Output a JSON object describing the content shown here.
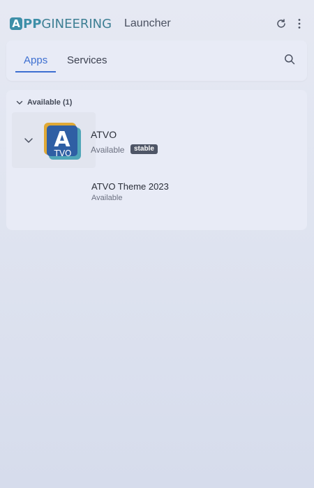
{
  "titlebar": {
    "logo_a": "A",
    "logo_pp": "PP",
    "logo_rest": "GINEERING",
    "title": "Launcher",
    "icons": [
      "refresh-icon",
      "more-vertical-icon"
    ]
  },
  "tabs": {
    "items": [
      {
        "label": "Apps",
        "active": true
      },
      {
        "label": "Services",
        "active": false
      }
    ],
    "search_icon": "search-icon",
    "accent_color": "#3d6fd1"
  },
  "groups": [
    {
      "label": "Available (1)",
      "expanded": true,
      "apps": [
        {
          "name": "ATVO",
          "status": "Available",
          "badge": "stable",
          "icon_letter": "A",
          "icon_text": "TVO",
          "children": [
            {
              "name": "ATVO Theme 2023",
              "status": "Available"
            }
          ]
        }
      ]
    }
  ]
}
